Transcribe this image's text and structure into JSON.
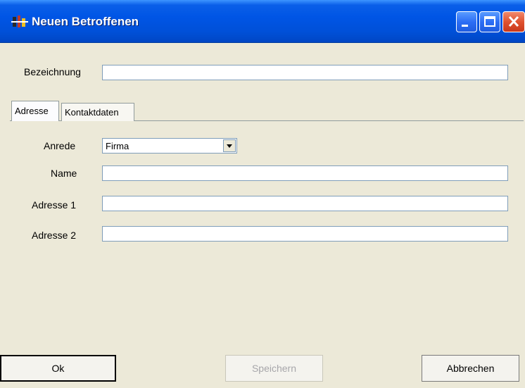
{
  "window": {
    "title": "Neuen Betroffenen"
  },
  "form": {
    "bezeichnung_label": "Bezeichnung",
    "bezeichnung_value": ""
  },
  "tabs": [
    {
      "label": "Adresse",
      "active": true
    },
    {
      "label": "Kontaktdaten",
      "active": false
    }
  ],
  "address": {
    "anrede_label": "Anrede",
    "anrede_value": "Firma",
    "name_label": "Name",
    "name_value": "",
    "adresse1_label": "Adresse 1",
    "adresse1_value": "",
    "adresse2_label": "Adresse 2",
    "adresse2_value": ""
  },
  "buttons": {
    "ok": "Ok",
    "save": "Speichern",
    "cancel": "Abbrechen"
  },
  "colors": {
    "titlebar": "#0054e3",
    "window_bg": "#ece9d8",
    "close_button": "#e0522f"
  }
}
